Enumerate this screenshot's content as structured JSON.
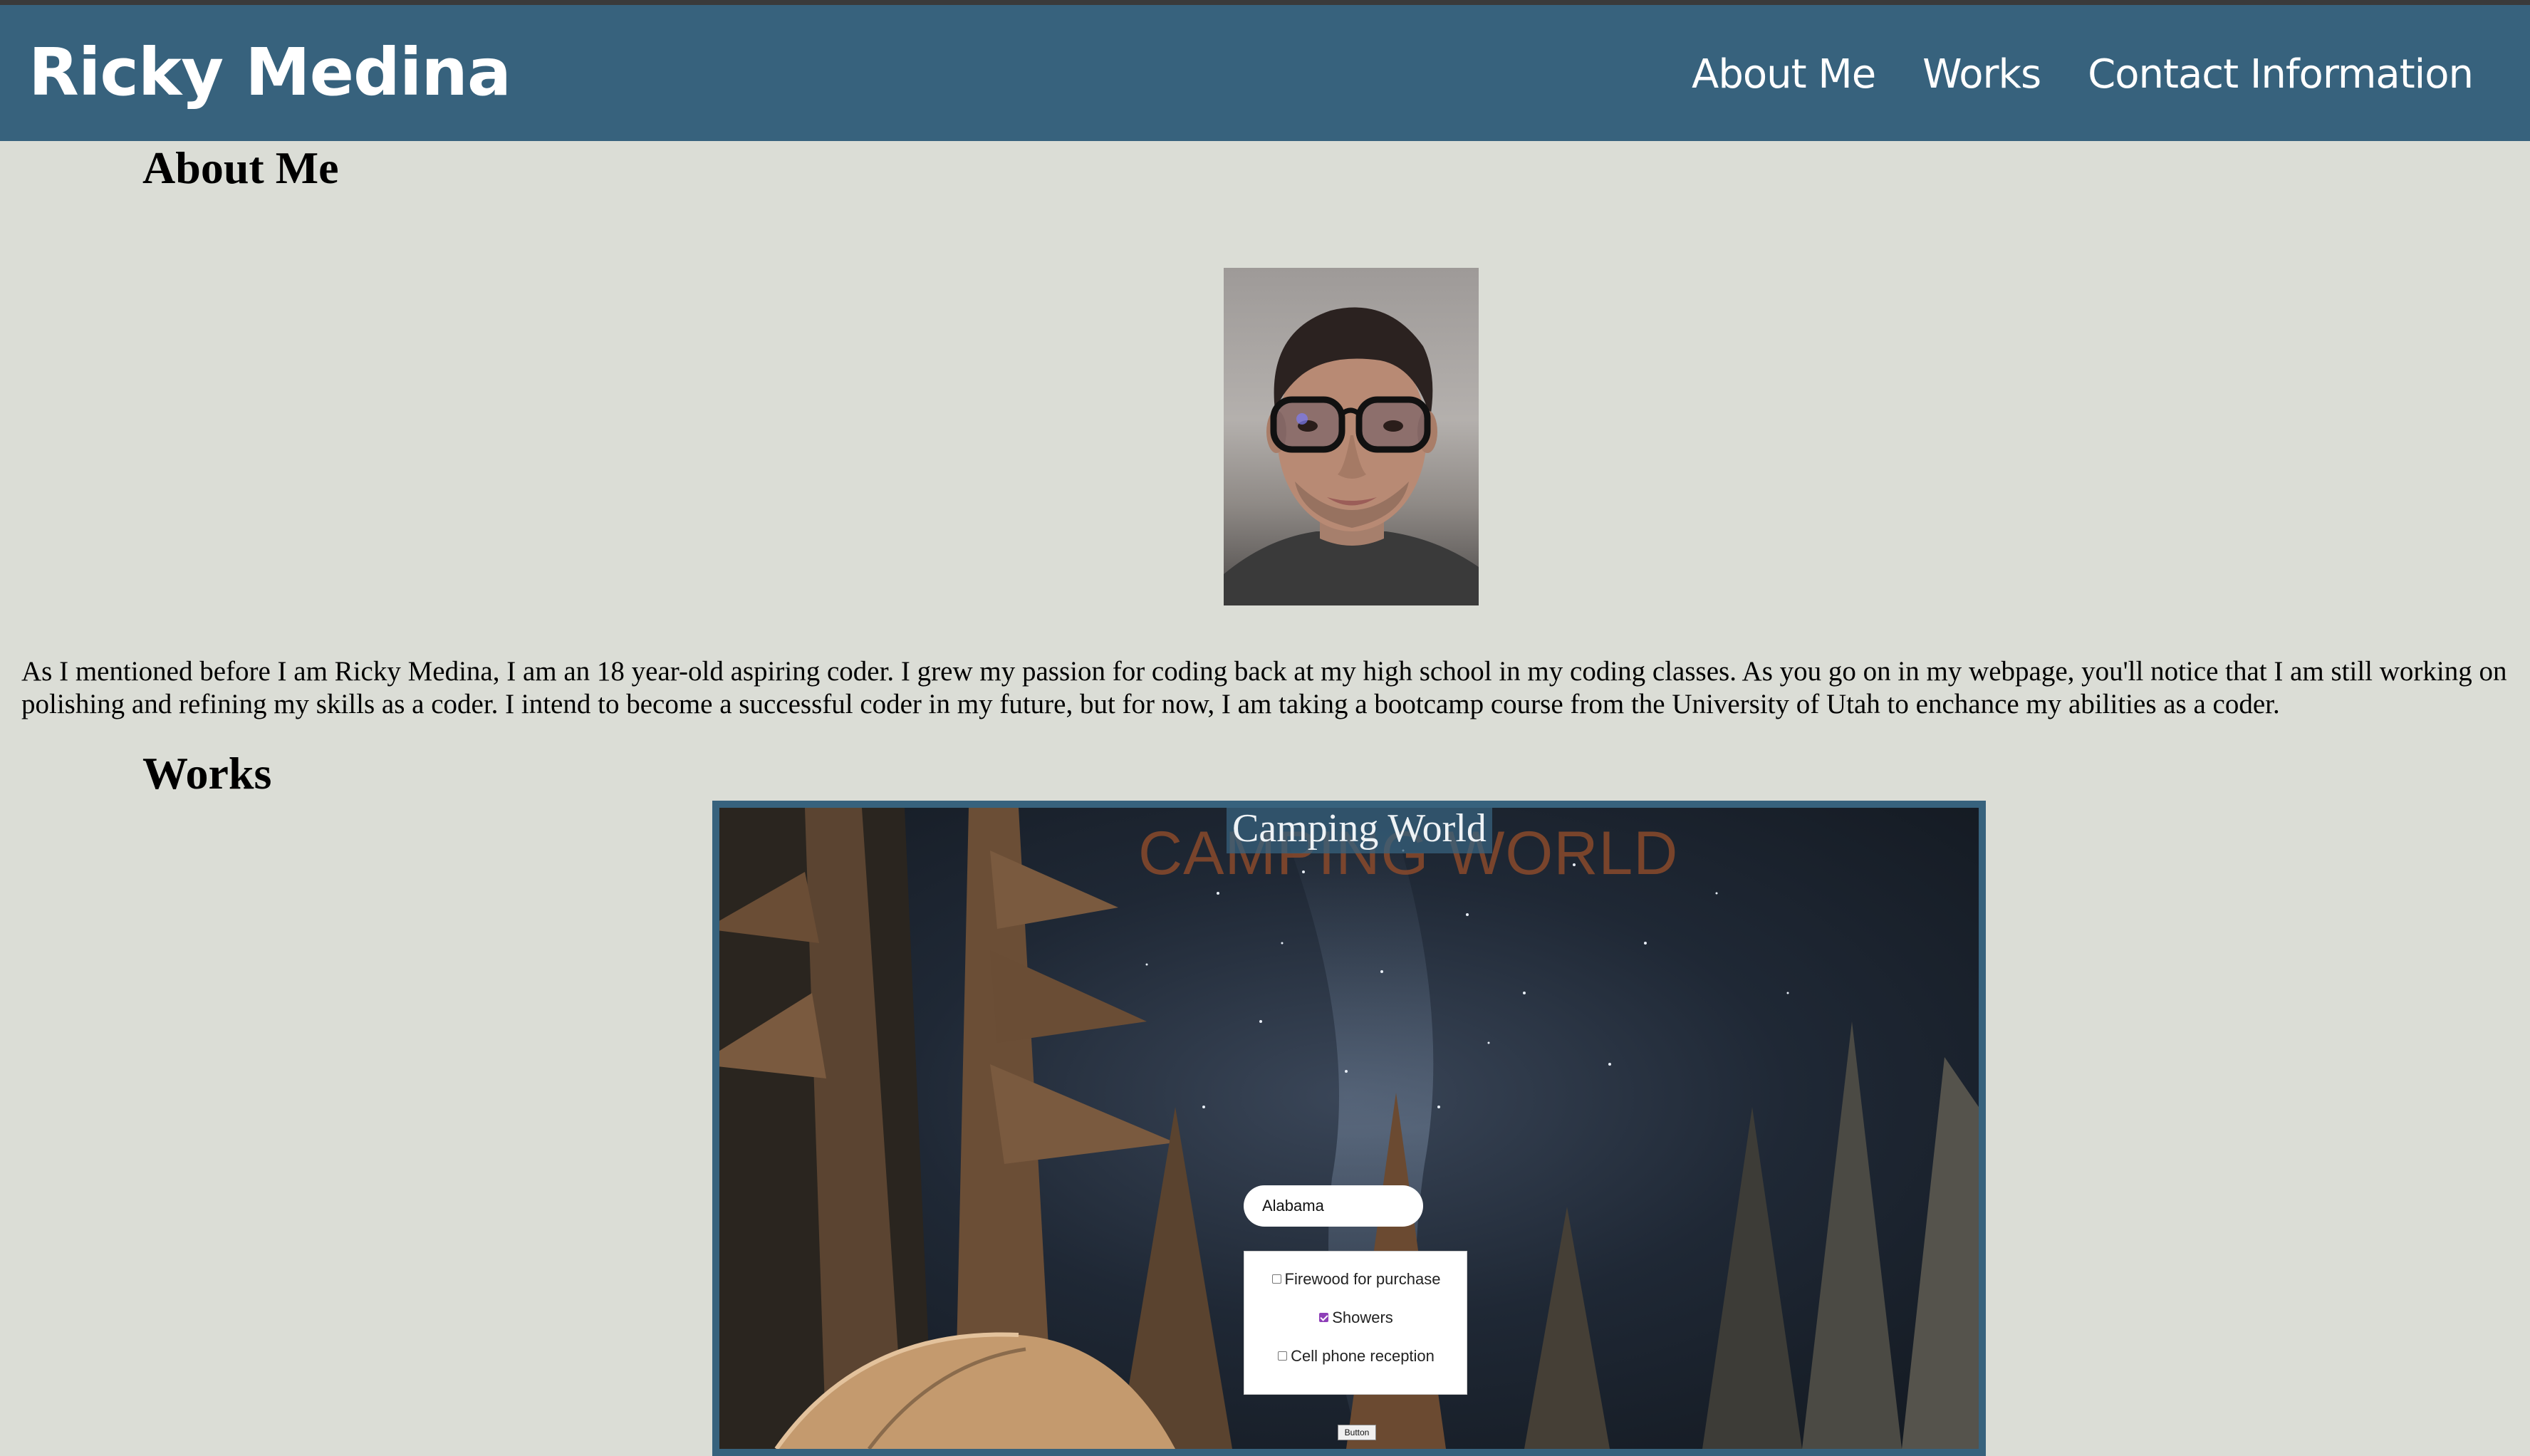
{
  "header": {
    "brand": "Ricky Medina",
    "nav": [
      "About Me",
      "Works",
      "Contact Information"
    ],
    "background": "#37627d"
  },
  "about": {
    "title": "About Me",
    "text": "As I mentioned before I am Ricky Medina, I am an 18 year-old aspiring coder. I grew my passion for coding back at my high school in my coding classes. As you go on in my webpage, you'll notice that I am still working on polishing and refining my skills as a coder. I intend to become a successful coder in my future, but for now, I am taking a bootcamp course from the University of Utah to enchance my abilities as a coder."
  },
  "works": {
    "title": "Works",
    "project": {
      "label": "Camping World",
      "site_heading": "CAMPING WORLD",
      "state_value": "Alabama",
      "amenities": [
        {
          "label": "Firewood for purchase",
          "checked": false
        },
        {
          "label": "Showers",
          "checked": true
        },
        {
          "label": "Cell phone reception",
          "checked": false
        }
      ],
      "button_label": "Button"
    }
  },
  "colors": {
    "page_background": "#dbddd6",
    "checkbox_accent": "#8e3fb8"
  }
}
